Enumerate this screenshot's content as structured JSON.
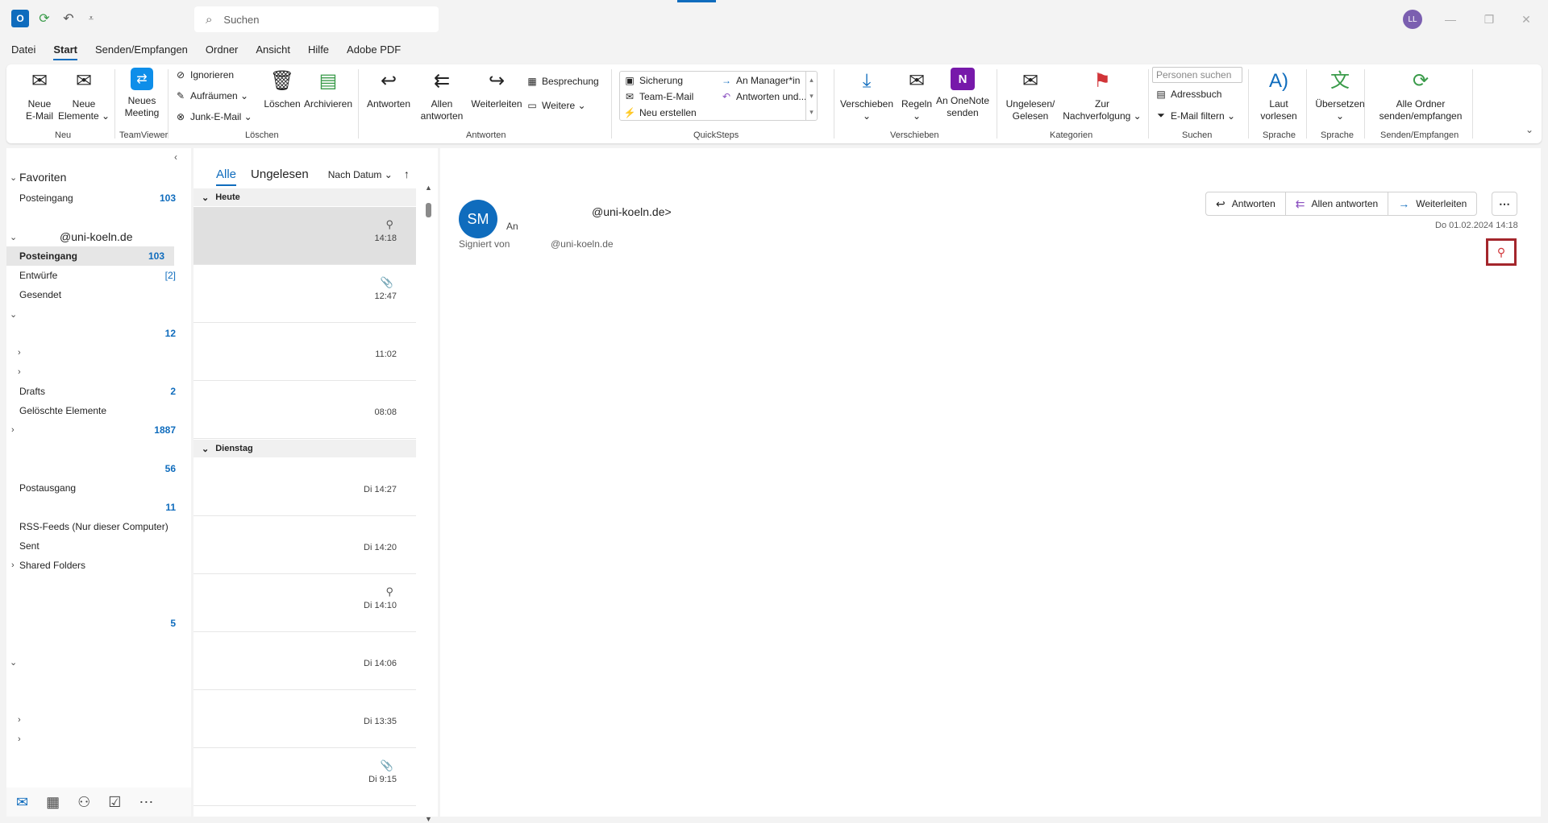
{
  "titlebar": {
    "search_placeholder": "Suchen",
    "avatar_initials": "LL"
  },
  "menu": [
    "Datei",
    "Start",
    "Senden/Empfangen",
    "Ordner",
    "Ansicht",
    "Hilfe",
    "Adobe PDF"
  ],
  "ribbon": {
    "neue_email": "Neue\nE-Mail",
    "neue_elemente": "Neue\nElemente ⌄",
    "neues_meeting": "Neues\nMeeting",
    "ignorieren": "Ignorieren",
    "aufraeumen": "Aufräumen ⌄",
    "junk": "Junk-E-Mail ⌄",
    "loeschen": "Löschen",
    "archivieren": "Archivieren",
    "antworten": "Antworten",
    "allen_antworten": "Allen\nantworten",
    "weiterleiten": "Weiterleiten",
    "besprechung": "Besprechung",
    "weitere": "Weitere ⌄",
    "qs_sicherung": "Sicherung",
    "qs_team": "Team-E-Mail",
    "qs_neu": "Neu erstellen",
    "qs_manager": "An Manager*in",
    "qs_antworten_und": "Antworten und...",
    "verschieben": "Verschieben\n⌄",
    "regeln": "Regeln\n⌄",
    "onenote": "An OneNote\nsenden",
    "ungelesen": "Ungelesen/\nGelesen",
    "nachverfolgung": "Zur\nNachverfolgung ⌄",
    "personen_placeholder": "Personen suchen",
    "adressbuch": "Adressbuch",
    "filtern": "E-Mail filtern ⌄",
    "laut": "Laut\nvorlesen",
    "uebersetzen": "Übersetzen\n⌄",
    "alle_ordner": "Alle Ordner\nsenden/empfangen",
    "groups": {
      "neu": "Neu",
      "teamviewer": "TeamViewer",
      "loeschen": "Löschen",
      "antworten": "Antworten",
      "quicksteps": "QuickSteps",
      "verschieben": "Verschieben",
      "kategorien": "Kategorien",
      "suchen": "Suchen",
      "sprache1": "Sprache",
      "sprache2": "Sprache",
      "senden": "Senden/Empfangen"
    }
  },
  "nav": {
    "favoriten": "Favoriten",
    "fav_posteingang": "Posteingang",
    "fav_posteingang_count": "103",
    "account": "@uni-koeln.de",
    "posteingang": "Posteingang",
    "posteingang_count": "103",
    "entwuerfe": "Entwürfe",
    "entwuerfe_count": "[2]",
    "gesendet": "Gesendet",
    "count_12": "12",
    "drafts": "Drafts",
    "drafts_count": "2",
    "geloeschte": "Gelöschte Elemente",
    "count_1887": "1887",
    "count_56": "56",
    "postausgang": "Postausgang",
    "count_11": "11",
    "rss": "RSS-Feeds (Nur dieser Computer)",
    "sent": "Sent",
    "shared": "Shared Folders",
    "count_5": "5"
  },
  "msglist": {
    "tab_alle": "Alle",
    "tab_ungelesen": "Ungelesen",
    "sort": "Nach Datum ⌄",
    "group_heute": "Heute",
    "group_dienstag": "Dienstag",
    "times_heute": [
      "14:18",
      "12:47",
      "11:02",
      "08:08"
    ],
    "times_dienstag": [
      "Di 14:27",
      "Di 14:20",
      "Di 14:10",
      "Di 14:06",
      "Di 13:35",
      "Di 9:15"
    ]
  },
  "reading": {
    "avatar": "SM",
    "to_label": "An",
    "sender_email": "@uni-koeln.de>",
    "signed_by_label": "Signiert von",
    "signed_by": "@uni-koeln.de",
    "date": "Do 01.02.2024 14:18",
    "btn_antworten": "Antworten",
    "btn_allen": "Allen antworten",
    "btn_weiterleiten": "Weiterleiten"
  }
}
